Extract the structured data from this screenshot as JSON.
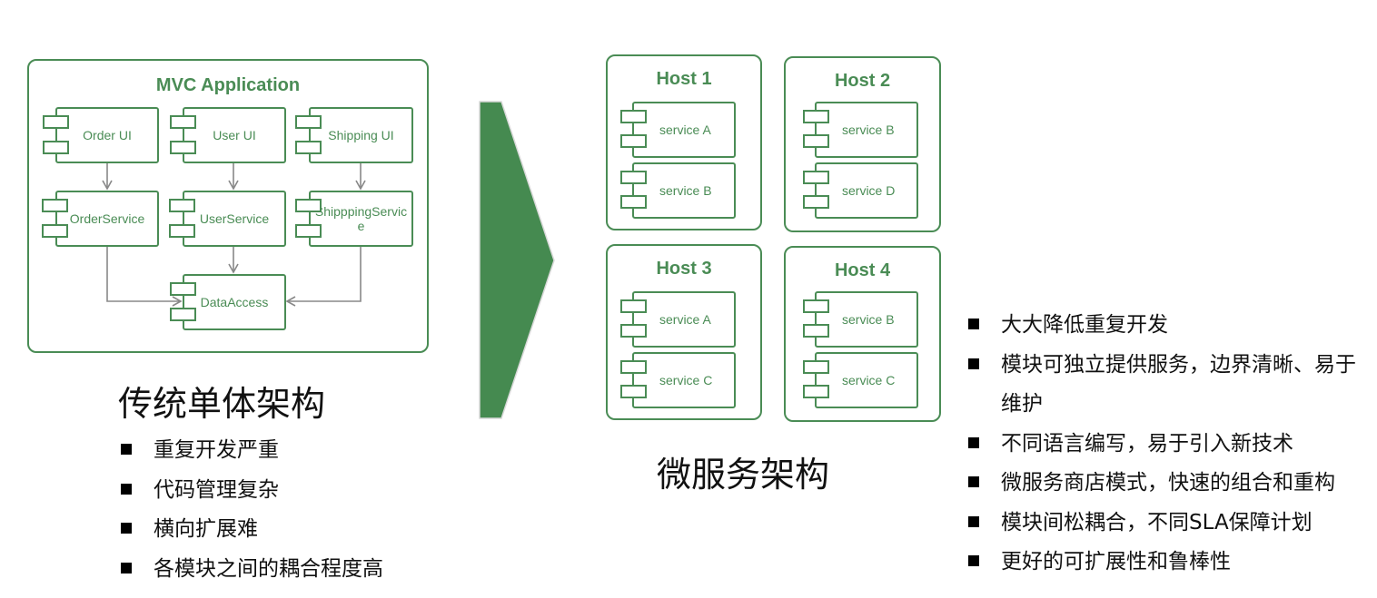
{
  "colors": {
    "green": "#4a8c55",
    "arrow_fill": "#458a50",
    "connector": "#888888",
    "text": "#111111"
  },
  "monolith": {
    "title": "MVC Application",
    "components": {
      "order_ui": "Order UI",
      "user_ui": "User UI",
      "shipping_ui": "Shipping UI",
      "order_service": "OrderService",
      "user_service": "UserService",
      "shipping_service": "ShipppingService",
      "data_access": "DataAccess"
    },
    "heading": "传统单体架构",
    "bullets": [
      "重复开发严重",
      "代码管理复杂",
      "横向扩展难",
      "各模块之间的耦合程度高"
    ]
  },
  "transition_arrow": "chevron-right-arrow",
  "microservices": {
    "hosts": [
      {
        "title": "Host 1",
        "services": [
          "service A",
          "service B"
        ]
      },
      {
        "title": "Host 2",
        "services": [
          "service B",
          "service D"
        ]
      },
      {
        "title": "Host 3",
        "services": [
          "service A",
          "service C"
        ]
      },
      {
        "title": "Host 4",
        "services": [
          "service B",
          "service C"
        ]
      }
    ],
    "heading": "微服务架构",
    "bullets": [
      "大大降低重复开发",
      "模块可独立提供服务，边界清晰、易于维护",
      "不同语言编写，易于引入新技术",
      "微服务商店模式，快速的组合和重构",
      "模块间松耦合，不同SLA保障计划",
      "更好的可扩展性和鲁棒性"
    ]
  }
}
